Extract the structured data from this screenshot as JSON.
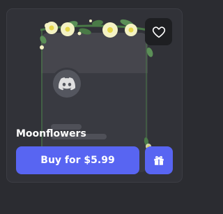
{
  "item": {
    "name": "Moonflowers",
    "buy_label": "Buy for $5.99"
  },
  "icons": {
    "favorite": "heart-outline-icon",
    "gift": "gift-icon",
    "avatar": "discord-logo-icon"
  },
  "colors": {
    "accent": "#5865f2",
    "card_bg": "#313238",
    "page_bg": "#2b2c31",
    "flower_petal": "#f4f2c4",
    "flower_center": "#e6d84a",
    "leaf": "#4a7a47"
  }
}
